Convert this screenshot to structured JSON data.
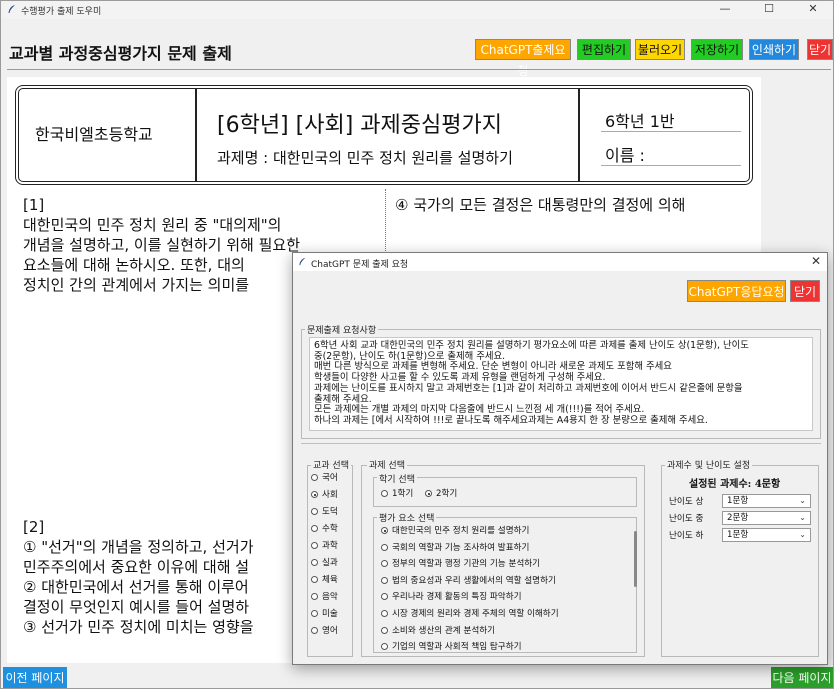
{
  "window": {
    "title": "수행평가 출제 도우미"
  },
  "header": {
    "title": "교과별 과정중심평가지 문제 출제"
  },
  "toolbar": {
    "buttons": [
      {
        "label": "ChatGPT출제요청",
        "bg": "#ffa500"
      },
      {
        "label": "편집하기",
        "bg": "#22cc22"
      },
      {
        "label": "불러오기",
        "bg": "#ffd700"
      },
      {
        "label": "저장하기",
        "bg": "#22cc22"
      },
      {
        "label": "인쇄하기",
        "bg": "#2288dd"
      },
      {
        "label": "닫기",
        "bg": "#ee3333"
      }
    ]
  },
  "doc": {
    "school": "한국비엘초등학교",
    "title": "[6학년] [사회] 과제중심평가지",
    "task": "과제명 : 대한민국의 민주 정치 원리를 설명하기",
    "grade": "6학년 1반",
    "name_label": "이름 :",
    "q1": "[1]\n대한민국의 민주 정치 원리 중 \"대의제\"의\n개념을 설명하고, 이를 실현하기 위해 필요한\n요소들에 대해 논하시오. 또한, 대의\n정치인 간의 관계에서 가지는 의미를",
    "q1_option4": "④ 국가의 모든 결정은 대통령만의 결정에 의해",
    "q2": "[2]\n① \"선거\"의 개념을 정의하고, 선거가\n민주주의에서 중요한 이유에 대해 설\n② 대한민국에서 선거를 통해 이루어\n결정이 무엇인지 예시를 들어 설명하\n③ 선거가 민주 정치에 미치는 영향을"
  },
  "nav": {
    "prev": "이전 페이지",
    "next": "다음 페이지"
  },
  "dialog": {
    "title": "ChatGPT 문제 출제 요청",
    "response_button": "ChatGPT응답요청",
    "close_button": "닫기",
    "request_label": "문제출제 요청사항",
    "request_text": "6학년 사회 교과 대한민국의 민주 정치 원리를 설명하기 평가요소에 따른 과제를 출제 난이도 상(1문항), 난이도\n중(2문항), 난이도 하(1문항)으로 출제해 주세요.\n매번 다른 방식으로 과제를 변형해 주세요. 단순 변형이 아니라 새로운 과제도 포함해 주세요\n학생들이 다양한 사고를 할 수 있도록 과제 유형을 랜덤하게 구성해 주세요.\n과제에는 난이도를 표시하지 말고 과제번호는 [1]과 같이 처리하고 과제번호에 이어서 반드시 같은줄에 문항을\n출제해 주세요.\n모든 과제에는 개별 과제의 마지막 다음줄에 반드시 느낀점 세 개(!!!)를 적어 주세요.\n하나의 과제는 [에서 시작하여 !!!로 끝나도록 해주세요과제는 A4용지 한 장 분량으로 출제해 주세요.",
    "subject": {
      "label": "교과 선택",
      "items": [
        "국어",
        "사회",
        "도덕",
        "수학",
        "과학",
        "실과",
        "체육",
        "음악",
        "미술",
        "영어"
      ],
      "selected": 1
    },
    "task_select": {
      "label": "과제 선택",
      "semester_label": "학기 선택",
      "semesters": [
        "1학기",
        "2학기"
      ],
      "semester_selected": 1,
      "eval_label": "평가 요소 선택",
      "items": [
        "대한민국의 민주 정치 원리를 설명하기",
        "국회의 역할과 기능 조사하여 발표하기",
        "정부의 역할과 행정 기관의 기능 분석하기",
        "법의 중요성과 우리 생활에서의 역할 설명하기",
        "우리나라 경제 활동의 특징 파악하기",
        "시장 경제의 원리와 경제 주체의 역할 이해하기",
        "소비와 생산의 관계 분석하기",
        "기업의 역할과 사회적 책임 탐구하기"
      ],
      "selected": 0
    },
    "difficulty": {
      "label": "과제수 및 난이도 설정",
      "total": "설정된 과제수: 4문항",
      "rows": [
        {
          "label": "난이도 상",
          "value": "1문항"
        },
        {
          "label": "난이도 중",
          "value": "2문항"
        },
        {
          "label": "난이도 하",
          "value": "1문항"
        }
      ]
    }
  }
}
